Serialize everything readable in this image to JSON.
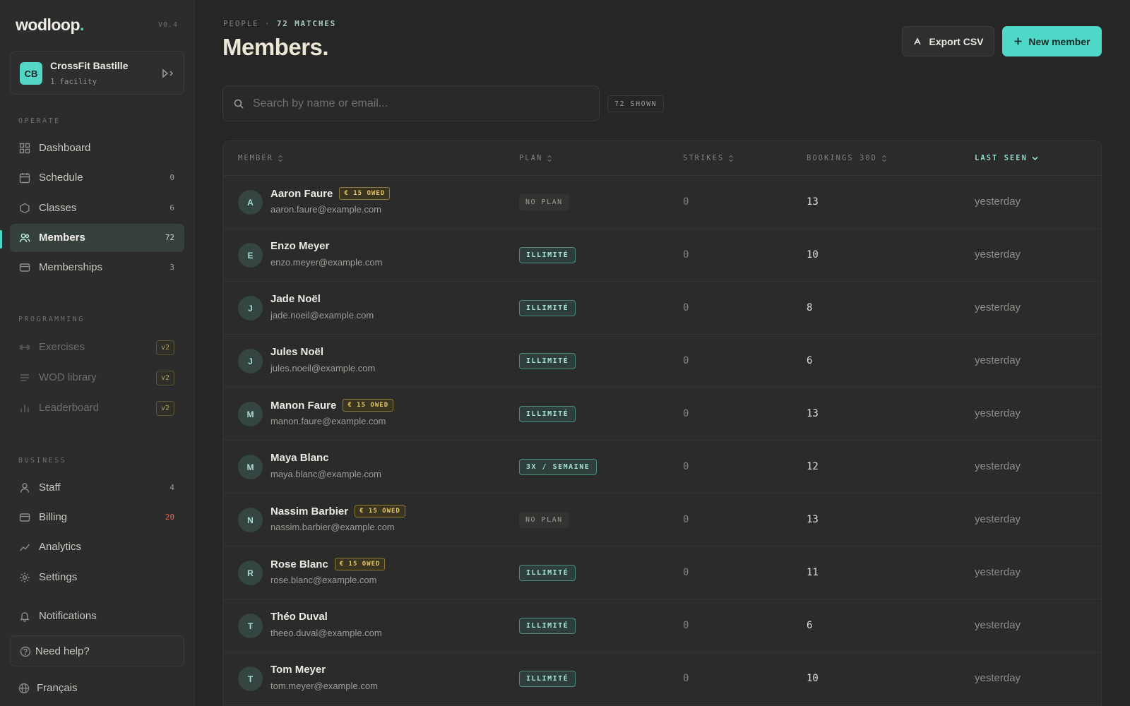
{
  "app": {
    "brand": "wodloop",
    "brand_dot": ".",
    "version": "V0.4"
  },
  "org": {
    "initials": "CB",
    "name": "CrossFit Bastille",
    "sub": "1 facility"
  },
  "sidebar": {
    "sections": {
      "operate": "OPERATE",
      "programming": "PROGRAMMING",
      "business": "BUSINESS"
    },
    "operate": [
      {
        "label": "Dashboard",
        "count": ""
      },
      {
        "label": "Schedule",
        "count": "0"
      },
      {
        "label": "Classes",
        "count": "6"
      },
      {
        "label": "Members",
        "count": "72"
      },
      {
        "label": "Memberships",
        "count": "3"
      }
    ],
    "programming": [
      {
        "label": "Exercises",
        "badge": "v2"
      },
      {
        "label": "WOD library",
        "badge": "v2"
      },
      {
        "label": "Leaderboard",
        "badge": "v2"
      }
    ],
    "business": [
      {
        "label": "Staff",
        "count": "4"
      },
      {
        "label": "Billing",
        "count": "20"
      },
      {
        "label": "Analytics",
        "count": ""
      },
      {
        "label": "Settings",
        "count": ""
      }
    ],
    "notifications": "Notifications",
    "help": "Need help?",
    "language": "Français"
  },
  "header": {
    "eyebrow_section": "PEOPLE",
    "eyebrow_sep": "·",
    "eyebrow_count": "72 MATCHES",
    "title": "Members.",
    "export_label": "Export CSV",
    "new_label": "New member"
  },
  "search": {
    "placeholder": "Search by name or email...",
    "value": "",
    "shown": "72 SHOWN"
  },
  "table": {
    "columns": [
      "MEMBER",
      "PLAN",
      "STRIKES",
      "BOOKINGS 30D",
      "LAST SEEN"
    ],
    "rows": [
      {
        "initial": "A",
        "name": "Aaron Faure",
        "owed": "€ 15 OWED",
        "email": "aaron.faure@example.com",
        "plan": "NO PLAN",
        "strikes": "0",
        "bookings": "13",
        "last_seen": "yesterday"
      },
      {
        "initial": "E",
        "name": "Enzo Meyer",
        "owed": "",
        "email": "enzo.meyer@example.com",
        "plan": "ILLIMITÉ",
        "strikes": "0",
        "bookings": "10",
        "last_seen": "yesterday"
      },
      {
        "initial": "J",
        "name": "Jade Noël",
        "owed": "",
        "email": "jade.noeil@example.com",
        "plan": "ILLIMITÉ",
        "strikes": "0",
        "bookings": "8",
        "last_seen": "yesterday"
      },
      {
        "initial": "J",
        "name": "Jules Noël",
        "owed": "",
        "email": "jules.noeil@example.com",
        "plan": "ILLIMITÉ",
        "strikes": "0",
        "bookings": "6",
        "last_seen": "yesterday"
      },
      {
        "initial": "M",
        "name": "Manon Faure",
        "owed": "€ 15 OWED",
        "email": "manon.faure@example.com",
        "plan": "ILLIMITÉ",
        "strikes": "0",
        "bookings": "13",
        "last_seen": "yesterday"
      },
      {
        "initial": "M",
        "name": "Maya Blanc",
        "owed": "",
        "email": "maya.blanc@example.com",
        "plan": "3X / SEMAINE",
        "strikes": "0",
        "bookings": "12",
        "last_seen": "yesterday"
      },
      {
        "initial": "N",
        "name": "Nassim Barbier",
        "owed": "€ 15 OWED",
        "email": "nassim.barbier@example.com",
        "plan": "NO PLAN",
        "strikes": "0",
        "bookings": "13",
        "last_seen": "yesterday"
      },
      {
        "initial": "R",
        "name": "Rose Blanc",
        "owed": "€ 15 OWED",
        "email": "rose.blanc@example.com",
        "plan": "ILLIMITÉ",
        "strikes": "0",
        "bookings": "11",
        "last_seen": "yesterday"
      },
      {
        "initial": "T",
        "name": "Théo Duval",
        "owed": "",
        "email": "theeo.duval@example.com",
        "plan": "ILLIMITÉ",
        "strikes": "0",
        "bookings": "6",
        "last_seen": "yesterday"
      },
      {
        "initial": "T",
        "name": "Tom Meyer",
        "owed": "",
        "email": "tom.meyer@example.com",
        "plan": "ILLIMITÉ",
        "strikes": "0",
        "bookings": "10",
        "last_seen": "yesterday"
      }
    ]
  },
  "colors": {
    "accent": "#4fd8c8",
    "owed": "#e4c566",
    "danger": "#e5604e"
  }
}
